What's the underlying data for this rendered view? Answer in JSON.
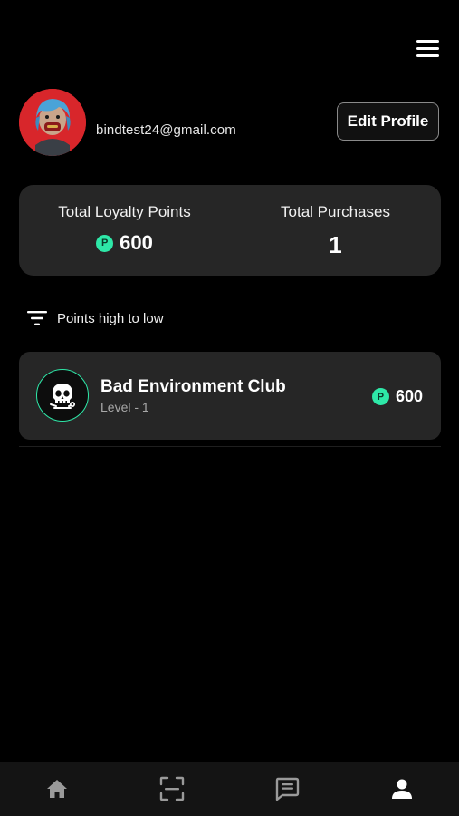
{
  "header": {
    "menu_icon": "hamburger-menu-icon"
  },
  "profile": {
    "email": "bindtest24@gmail.com",
    "edit_label": "Edit Profile",
    "avatar_color": "#d8262b"
  },
  "stats": {
    "loyalty_label": "Total Loyalty Points",
    "loyalty_value": "600",
    "purchases_label": "Total Purchases",
    "purchases_value": "1",
    "coin_symbol": "P",
    "coin_color": "#2ee8a8"
  },
  "sort": {
    "label": "Points high to low",
    "icon": "filter-sort-icon"
  },
  "clubs": [
    {
      "name": "Bad Environment Club",
      "level": "Level - 1",
      "points": "600",
      "logo_icon": "skull-logo-icon"
    }
  ],
  "nav": {
    "items": [
      "home-icon",
      "scan-icon",
      "chat-icon",
      "profile-icon"
    ],
    "active_index": 3
  }
}
